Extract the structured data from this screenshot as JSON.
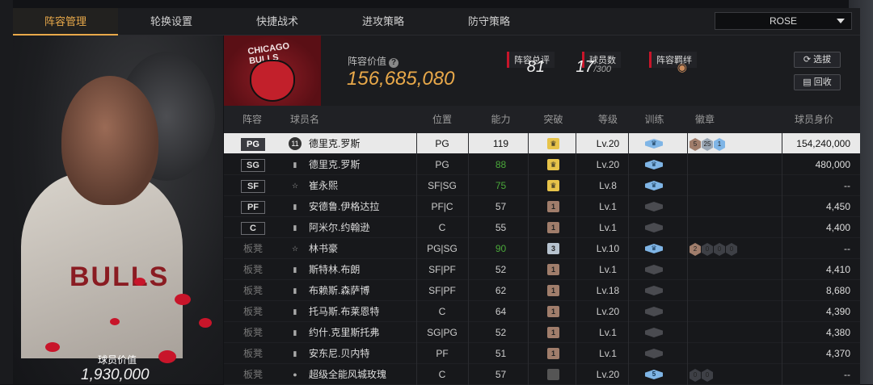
{
  "tabs": [
    {
      "label": "阵容管理",
      "active": true
    },
    {
      "label": "轮换设置"
    },
    {
      "label": "快捷战术"
    },
    {
      "label": "进攻策略"
    },
    {
      "label": "防守策略"
    }
  ],
  "dropdown": {
    "value": "ROSE"
  },
  "player": {
    "value_label": "球员价值",
    "value": "1,930,000"
  },
  "team": {
    "logo_text": "CHICAGO BULLS",
    "value_label": "阵容价值",
    "value": "156,685,080",
    "overall_label": "阵容总评",
    "overall": "81",
    "count_label": "球员数",
    "count": "17",
    "count_max": "/300",
    "bond_label": "阵容羁绊"
  },
  "buttons": {
    "filter": "选拔",
    "recycle": "回收"
  },
  "table": {
    "headers": [
      "阵容",
      "球员名",
      "位置",
      "能力",
      "突破",
      "等级",
      "训练",
      "徽章",
      "球员身价"
    ],
    "rows": [
      {
        "slot": "PG",
        "name": "德里克.罗斯",
        "pos": "PG",
        "ability": "119",
        "ability_color": "#111",
        "breakthrough": "crown",
        "level": "Lv.20",
        "train": "crown",
        "badges": [
          "5",
          "25",
          "1"
        ],
        "value": "154,240,000",
        "selected": true,
        "icon": "11"
      },
      {
        "slot": "SG",
        "name": "德里克.罗斯",
        "pos": "PG",
        "ability": "88",
        "ability_color": "#4aa83a",
        "breakthrough": "crown",
        "level": "Lv.20",
        "train": "crown",
        "badges": [],
        "value": "480,000",
        "icon": "bars"
      },
      {
        "slot": "SF",
        "name": "崔永熙",
        "pos": "SF|SG",
        "ability": "75",
        "ability_color": "#4aa83a",
        "breakthrough": "crown",
        "level": "Lv.8",
        "train": "crown",
        "badges": [],
        "value": "--",
        "icon": "star"
      },
      {
        "slot": "PF",
        "name": "安德鲁.伊格达拉",
        "pos": "PF|C",
        "ability": "57",
        "ability_color": "#ccc",
        "breakthrough": "1",
        "level": "Lv.1",
        "train": "gray",
        "badges": [],
        "value": "4,450",
        "icon": "bars"
      },
      {
        "slot": "C",
        "name": "阿米尔.约翰逊",
        "pos": "C",
        "ability": "55",
        "ability_color": "#ccc",
        "breakthrough": "1",
        "level": "Lv.1",
        "train": "gray",
        "badges": [],
        "value": "4,400",
        "icon": "bars"
      },
      {
        "slot": "板凳",
        "name": "林书豪",
        "pos": "PG|SG",
        "ability": "90",
        "ability_color": "#4aa83a",
        "breakthrough": "3",
        "level": "Lv.10",
        "train": "crown",
        "badges": [
          "2",
          "0",
          "0",
          "0"
        ],
        "value": "--",
        "icon": "star"
      },
      {
        "slot": "板凳",
        "name": "斯特林.布朗",
        "pos": "SF|PF",
        "ability": "52",
        "ability_color": "#ccc",
        "breakthrough": "1",
        "level": "Lv.1",
        "train": "gray",
        "badges": [],
        "value": "4,410",
        "icon": "bars"
      },
      {
        "slot": "板凳",
        "name": "布赖斯.森萨博",
        "pos": "SF|PF",
        "ability": "62",
        "ability_color": "#ccc",
        "breakthrough": "1",
        "level": "Lv.18",
        "train": "gray",
        "badges": [],
        "value": "8,680",
        "icon": "bars"
      },
      {
        "slot": "板凳",
        "name": "托马斯.布莱恩特",
        "pos": "C",
        "ability": "64",
        "ability_color": "#ccc",
        "breakthrough": "1",
        "level": "Lv.20",
        "train": "gray",
        "badges": [],
        "value": "4,390",
        "icon": "bars"
      },
      {
        "slot": "板凳",
        "name": "约什.克里斯托弗",
        "pos": "SG|PG",
        "ability": "52",
        "ability_color": "#ccc",
        "breakthrough": "1",
        "level": "Lv.1",
        "train": "gray",
        "badges": [],
        "value": "4,380",
        "icon": "bars"
      },
      {
        "slot": "板凳",
        "name": "安东尼.贝内特",
        "pos": "PF",
        "ability": "51",
        "ability_color": "#ccc",
        "breakthrough": "1",
        "level": "Lv.1",
        "train": "gray",
        "badges": [],
        "value": "4,370",
        "icon": "bars"
      },
      {
        "slot": "板凳",
        "name": "超级全能风城玫瑰",
        "pos": "C",
        "ability": "57",
        "ability_color": "#ccc",
        "breakthrough": "gray",
        "level": "Lv.20",
        "train": "5",
        "badges": [
          "0",
          "0"
        ],
        "value": "--",
        "icon": "person"
      }
    ]
  },
  "colors": {
    "accent": "#e9a94a",
    "red": "#c8152a",
    "crown": "#e7c34a",
    "train_blue": "#7fb5e6",
    "bronze": "#a07d6b"
  }
}
